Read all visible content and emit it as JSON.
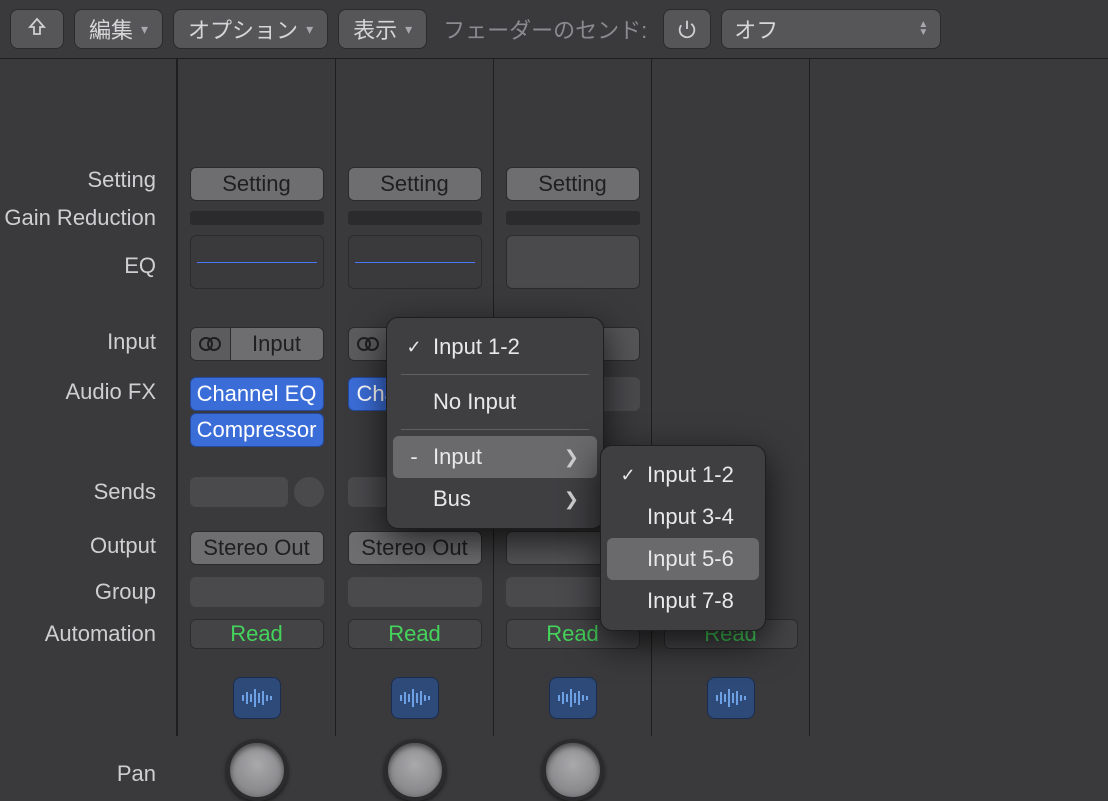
{
  "toolbar": {
    "edit": "編集",
    "option": "オプション",
    "view": "表示",
    "fader_send_label": "フェーダーのセンド:",
    "fader_send_value": "オフ"
  },
  "row_labels": {
    "setting": "Setting",
    "gain_reduction": "Gain Reduction",
    "eq": "EQ",
    "input": "Input",
    "audio_fx": "Audio FX",
    "sends": "Sends",
    "output": "Output",
    "group": "Group",
    "automation": "Automation",
    "pan": "Pan"
  },
  "channels": [
    {
      "setting": "Setting",
      "input": "Input",
      "fx": [
        "Channel EQ",
        "Compressor"
      ],
      "output": "Stereo Out",
      "automation": "Read",
      "has_eq_line": true
    },
    {
      "setting": "Setting",
      "input": "",
      "fx": [
        "Cha"
      ],
      "output": "Stereo Out",
      "automation": "Read",
      "has_eq_line": true
    },
    {
      "setting": "Setting",
      "input": "",
      "fx": [],
      "output": "",
      "automation": "Read",
      "has_eq_line": false
    },
    {
      "setting": "",
      "input": "",
      "fx": [],
      "output": "",
      "automation": "Read",
      "has_eq_line": false,
      "sparse": true
    }
  ],
  "menu1": {
    "item_input12": "Input 1-2",
    "item_noinput": "No Input",
    "item_input": "Input",
    "item_bus": "Bus"
  },
  "menu2": {
    "item_12": "Input 1-2",
    "item_34": "Input 3-4",
    "item_56": "Input 5-6",
    "item_78": "Input 7-8"
  }
}
